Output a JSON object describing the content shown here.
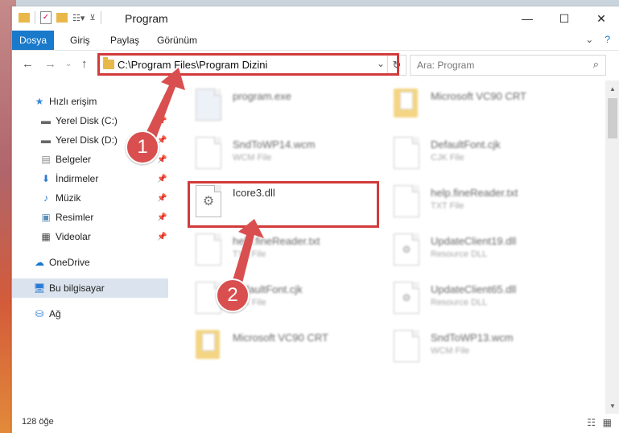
{
  "window": {
    "title": "Program"
  },
  "ribbon": {
    "tabs": [
      "Dosya",
      "Giriş",
      "Paylaş",
      "Görünüm"
    ]
  },
  "address": {
    "path": "C:\\Program Files\\Program Dizini",
    "search_placeholder": "Ara: Program"
  },
  "sidebar": {
    "items": [
      {
        "label": "Hızlı erişim",
        "icon": "star-icon"
      },
      {
        "label": "Yerel Disk (C:)",
        "icon": "drive-icon"
      },
      {
        "label": "Yerel Disk (D:)",
        "icon": "drive-icon"
      },
      {
        "label": "Belgeler",
        "icon": "documents-icon"
      },
      {
        "label": "İndirmeler",
        "icon": "download-icon"
      },
      {
        "label": "Müzik",
        "icon": "music-icon"
      },
      {
        "label": "Resimler",
        "icon": "pictures-icon"
      },
      {
        "label": "Videolar",
        "icon": "video-icon"
      },
      {
        "label": "OneDrive",
        "icon": "cloud-icon"
      },
      {
        "label": "Bu bilgisayar",
        "icon": "computer-icon"
      },
      {
        "label": "Ağ",
        "icon": "network-icon"
      }
    ]
  },
  "files": [
    {
      "name": "program.exe",
      "type": ""
    },
    {
      "name": "Microsoft VC90 CRT",
      "type": ""
    },
    {
      "name": "SndToWP14.wcm",
      "type": "WCM File"
    },
    {
      "name": "DefaultFont.cjk",
      "type": "CJK File"
    },
    {
      "name": "Icore3.dll",
      "type": ""
    },
    {
      "name": "help.fineReader.txt",
      "type": "TXT File"
    },
    {
      "name": "help.fineReader.txt",
      "type": "TXT File"
    },
    {
      "name": "UpdateClient19.dll",
      "type": "Resource DLL"
    },
    {
      "name": "DefaultFont.cjk",
      "type": "CJK File"
    },
    {
      "name": "UpdateClient65.dll",
      "type": "Resource DLL"
    },
    {
      "name": "Microsoft VC90 CRT",
      "type": ""
    },
    {
      "name": "SndToWP13.wcm",
      "type": "WCM File"
    }
  ],
  "status": {
    "item_count": "128 öğe"
  },
  "callouts": [
    "1",
    "2"
  ]
}
